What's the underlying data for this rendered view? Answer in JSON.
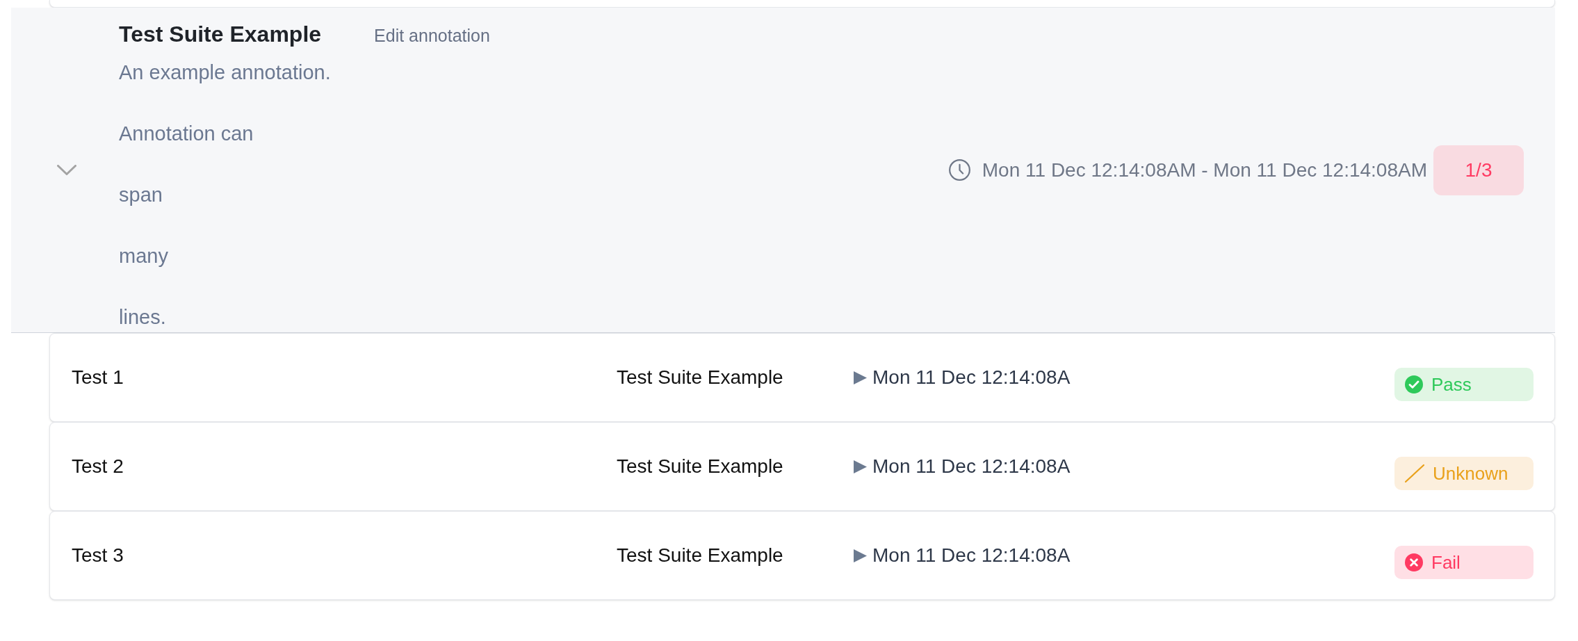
{
  "group": {
    "expanded": true,
    "title": "Test Suite Example",
    "edit_link": "Edit annotation",
    "annotation": [
      "An example annotation.",
      "Annotation can",
      "span",
      "many",
      "lines."
    ],
    "time_range": "Mon 11 Dec 12:14:08AM - Mon 11 Dec 12:14:08AM",
    "count_badge": {
      "label": "1/3",
      "kind": "fail"
    },
    "tests": [
      {
        "name": "Test 1",
        "suite": "Test Suite Example",
        "started": "Mon 11 Dec 12:14:08A",
        "result": {
          "kind": "pass",
          "label": "Pass"
        }
      },
      {
        "name": "Test 2",
        "suite": "Test Suite Example",
        "started": "Mon 11 Dec 12:14:08A",
        "result": {
          "kind": "unknown",
          "label": "Unknown"
        }
      },
      {
        "name": "Test 3",
        "suite": "Test Suite Example",
        "started": "Mon 11 Dec 12:14:08A",
        "result": {
          "kind": "fail",
          "label": "Fail"
        }
      }
    ]
  }
}
